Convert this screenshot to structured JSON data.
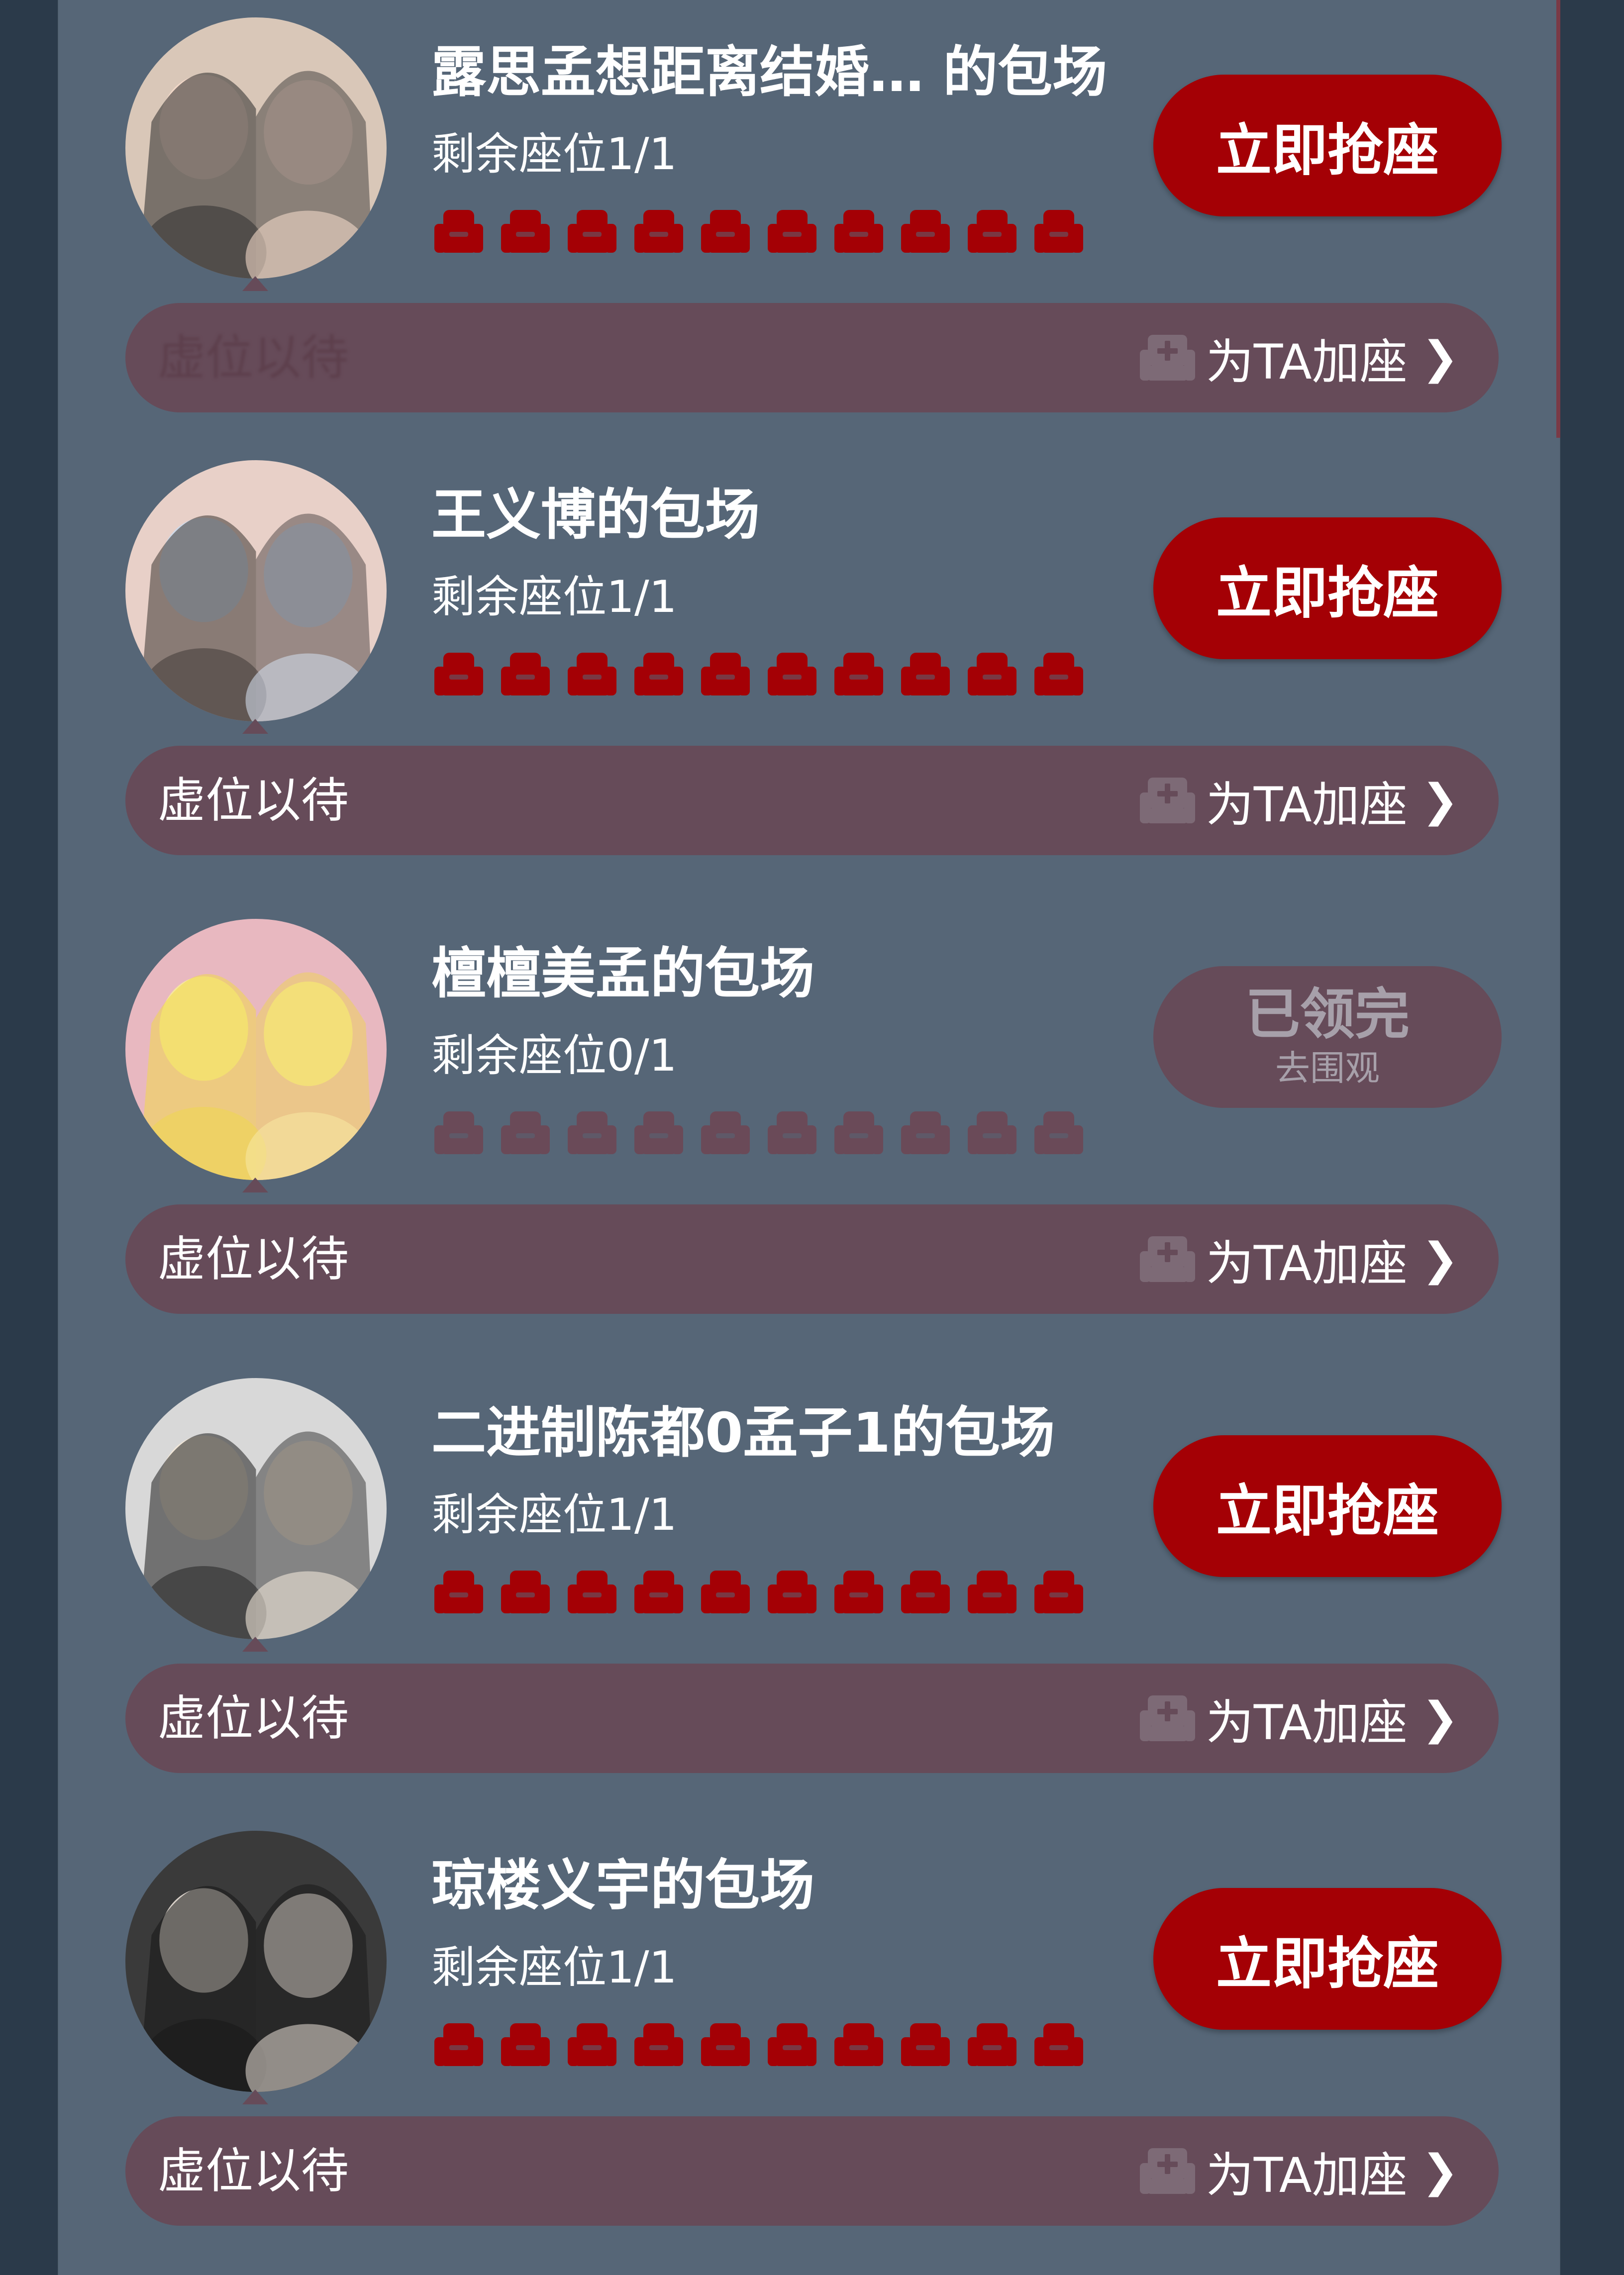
{
  "colors": {
    "background": "#2b3a4a",
    "panel": "#566677",
    "bar": "#664b59",
    "accent": "#a40005",
    "seat_available": "#a40005",
    "seat_taken": "#6a4a58"
  },
  "listings": [
    {
      "title": "露思孟想距离结婚… 的包场",
      "remaining": "剩余座位1/1",
      "seats_total": 10,
      "claimed": false,
      "action": "立即抢座",
      "waiting_text": "虚位以待",
      "waiting_obscured": true,
      "add_seat": "为TA加座",
      "avatar_icon": "avatar-photo"
    },
    {
      "title": "王义博的包场",
      "remaining": "剩余座位1/1",
      "seats_total": 10,
      "claimed": false,
      "action": "立即抢座",
      "waiting_text": "虚位以待",
      "waiting_obscured": false,
      "add_seat": "为TA加座",
      "avatar_icon": "avatar-photo"
    },
    {
      "title": "檀檀美孟的包场",
      "remaining": "剩余座位0/1",
      "seats_total": 10,
      "claimed": true,
      "action": "已领完",
      "action_sub": "去围观",
      "waiting_text": "虚位以待",
      "waiting_obscured": false,
      "add_seat": "为TA加座",
      "avatar_icon": "avatar-photo"
    },
    {
      "title": "二进制陈都0孟子1的包场",
      "remaining": "剩余座位1/1",
      "seats_total": 10,
      "claimed": false,
      "action": "立即抢座",
      "waiting_text": "虚位以待",
      "waiting_obscured": false,
      "add_seat": "为TA加座",
      "avatar_icon": "avatar-photo"
    },
    {
      "title": "琼楼义宇的包场",
      "remaining": "剩余座位1/1",
      "seats_total": 10,
      "claimed": false,
      "action": "立即抢座",
      "waiting_text": "虚位以待",
      "waiting_obscured": false,
      "add_seat": "为TA加座",
      "avatar_icon": "avatar-photo"
    }
  ]
}
